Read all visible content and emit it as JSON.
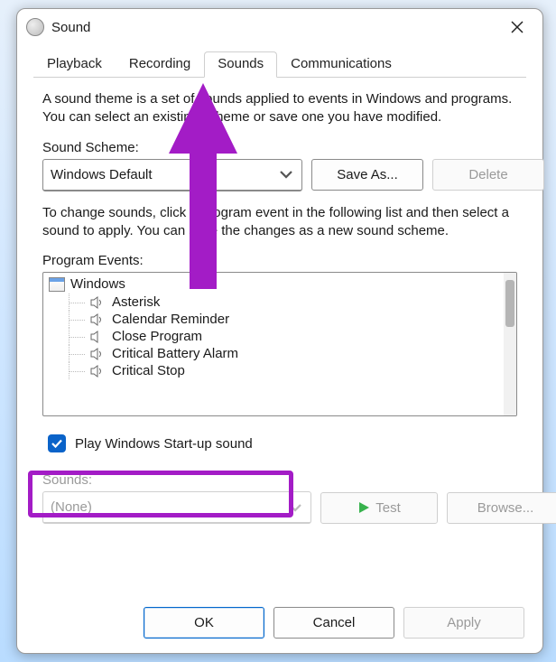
{
  "window": {
    "title": "Sound"
  },
  "tabs": [
    "Playback",
    "Recording",
    "Sounds",
    "Communications"
  ],
  "active_tab": 2,
  "description": "A sound theme is a set of sounds applied to events in Windows and programs.  You can select an existing scheme or save one you have modified.",
  "scheme": {
    "label": "Sound Scheme:",
    "value": "Windows Default",
    "save_as": "Save As...",
    "delete": "Delete"
  },
  "instructions": "To change sounds, click a program event in the following list and then select a sound to apply. You can save the changes as a new sound scheme.",
  "events": {
    "label": "Program Events:",
    "root": "Windows",
    "items": [
      "Asterisk",
      "Calendar Reminder",
      "Close Program",
      "Critical Battery Alarm",
      "Critical Stop"
    ]
  },
  "startup": {
    "label": "Play Windows Start-up sound",
    "checked": true
  },
  "sounds": {
    "label": "Sounds:",
    "value": "(None)",
    "test": "Test",
    "browse": "Browse..."
  },
  "footer": {
    "ok": "OK",
    "cancel": "Cancel",
    "apply": "Apply"
  }
}
